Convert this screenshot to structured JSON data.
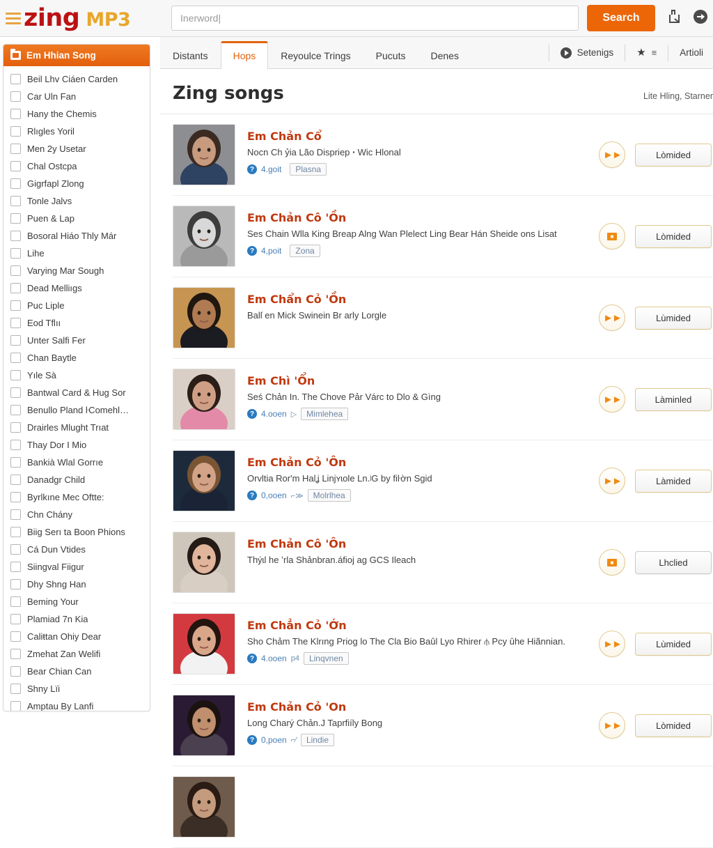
{
  "header": {
    "brand_first": "zing",
    "brand_second": "MP3",
    "menu_icon": "hamburger-icon",
    "search": {
      "value": "",
      "placeholder": "Inerword|",
      "button_label": "Search"
    },
    "icons": [
      {
        "name": "upload-icon",
        "label": "Upload"
      },
      {
        "name": "login-arrow-icon",
        "label": "Sign in"
      }
    ]
  },
  "sidebar": {
    "header_label": "Em Hhian Song",
    "header_icon": "folder-icon",
    "items": [
      {
        "label": "Beil Lhv Ciáen Carden",
        "checked": false
      },
      {
        "label": "Car Uln Fan",
        "checked": false
      },
      {
        "label": "Hany the Chemis",
        "checked": false
      },
      {
        "label": "Rlıgles Yoril",
        "checked": false
      },
      {
        "label": "Men 2y Usetar",
        "checked": false
      },
      {
        "label": "Chal Ostcpa",
        "checked": false
      },
      {
        "label": "Gigrfapl Zlong",
        "checked": false
      },
      {
        "label": "Tonle Jalvs",
        "checked": false
      },
      {
        "label": "Puen & Lap",
        "checked": false
      },
      {
        "label": "Bosoral Hiáo Thly Már",
        "checked": false
      },
      {
        "label": "Lihe",
        "checked": false
      },
      {
        "label": "Varying Mar Sough",
        "checked": false
      },
      {
        "label": "Dead Melliıgs",
        "checked": false
      },
      {
        "label": "Puc Liple",
        "checked": false
      },
      {
        "label": "Eod Tflıı",
        "checked": false
      },
      {
        "label": "Unter Salfi Fer",
        "checked": false
      },
      {
        "label": "Chan Baytle",
        "checked": false
      },
      {
        "label": "Yıle Sà",
        "checked": false
      },
      {
        "label": "Bantwal Card & Hug Sor",
        "checked": false
      },
      {
        "label": "Benullo Pland ŀComehl…",
        "checked": false
      },
      {
        "label": "Drairles Mlught Trıat",
        "checked": false
      },
      {
        "label": "Thay Dor I Mio",
        "checked": false
      },
      {
        "label": "Bankià Wlal Gorrıe",
        "checked": false
      },
      {
        "label": "Danadgr Child",
        "checked": false
      },
      {
        "label": "Byrlkıne Mec Oftte:",
        "checked": false
      },
      {
        "label": "Chn Chány",
        "checked": false
      },
      {
        "label": "Biig Serı ta Boon Phions",
        "checked": false
      },
      {
        "label": "Cá Dun Vtides",
        "checked": false
      },
      {
        "label": "Siingval Fiigur",
        "checked": false
      },
      {
        "label": "Dhy Shng Han",
        "checked": false
      },
      {
        "label": "Bemіng Your",
        "checked": false
      },
      {
        "label": "Plamiad 7n Kia",
        "checked": false
      },
      {
        "label": "Caliŧtan Ohiy Dear",
        "checked": false
      },
      {
        "label": "Zmehat Zan Welifi",
        "checked": false
      },
      {
        "label": "Bear Chian Can",
        "checked": false
      },
      {
        "label": "Shny Lïi",
        "checked": false
      },
      {
        "label": "Amptau By Lanfi",
        "checked": false
      }
    ]
  },
  "tabs": {
    "items": [
      {
        "label": "Distants",
        "active": false
      },
      {
        "label": "Hops",
        "active": true
      },
      {
        "label": "Reyoulce Trings",
        "active": false
      },
      {
        "label": "Pucuts",
        "active": false
      },
      {
        "label": "Denes",
        "active": false
      }
    ],
    "right": [
      {
        "label": "Setenigs",
        "icon": "play-circle-icon"
      },
      {
        "label": "",
        "icon": "star-filter-icon"
      },
      {
        "label": "Artioli",
        "icon": null
      }
    ]
  },
  "main": {
    "title": "Zing songs",
    "title_right": "Lite Hling, Starner",
    "songs": [
      {
        "title": "Em Chản Cổ",
        "desc": "Nocn Ch ỷia Lão Dispriep ꞏ Wic Hlonal",
        "meta": {
          "count": "4.goit",
          "arrow": "",
          "tag": "Plasna"
        },
        "action_icon": "fast-forward-icon",
        "action_label": "Lòmided",
        "thumb": {
          "bg": "#8d8e92",
          "skin": "#c89b7f",
          "hair": "#3a2a22",
          "cloth": "#2e4262"
        }
      },
      {
        "title": "Em Chản Cô 'Ồn",
        "desc": "Ses Chain Wlla King Breap Alng Wan Plelect Ling Bear Hán Sheide ons Lisat",
        "meta": {
          "count": "4,poit",
          "arrow": "",
          "tag": "Zona"
        },
        "action_icon": "stop-square-icon",
        "action_label": "Lòmided",
        "thumb": {
          "bg": "#b9b9b9",
          "skin": "#d8d8d8",
          "hair": "#3d3d3d",
          "cloth": "#9a9a9a"
        }
      },
      {
        "title": "Em Chẩn Cỏ 'Ồn",
        "desc": "Balſ en Mick Swinein Br arly Lorgle",
        "meta": null,
        "action_icon": "fast-forward-icon",
        "action_label": "Lùmided",
        "thumb": {
          "bg": "#c79552",
          "skin": "#b07b52",
          "hair": "#1f1710",
          "cloth": "#1b1b22"
        }
      },
      {
        "title": "Em Chì 'Ổn",
        "desc": "Seś Chản In. The Chove Pảr Várc to Dlo & Gìng",
        "meta": {
          "count": "4.ooen",
          "arrow": "▷",
          "tag": "Mimlehea"
        },
        "action_icon": "fast-forward-icon",
        "action_label": "Làminled",
        "thumb": {
          "bg": "#d9cfc6",
          "skin": "#cf9f85",
          "hair": "#2b1d18",
          "cloth": "#e38aa8"
        }
      },
      {
        "title": "Em Chản Cỏ 'Ôn",
        "desc": "Orvltia Ror'm Halʝ Linjʏɩole Ln.ʲG by fiŀờn Sgid",
        "meta": {
          "count": "0,ooen",
          "arrow": "⌐≫",
          "tag": "Molrlhea"
        },
        "action_icon": "fast-forward-icon",
        "action_label": "Làmided",
        "thumb": {
          "bg": "#1d2a3c",
          "skin": "#d3a387",
          "hair": "#7a5533",
          "cloth": "#1a2436"
        }
      },
      {
        "title": "Em Chản Cô 'Ôn",
        "desc": "Thýɩl he ʼrla Shảnbran.áfioj ag GCS Ileach",
        "meta": null,
        "action_icon": "stop-square-icon",
        "action_label": "Lhclied",
        "thumb": {
          "bg": "#cfc6bb",
          "skin": "#e0b59c",
          "hair": "#241a16",
          "cloth": "#d9cec4"
        }
      },
      {
        "title": "Em Chẳn Cỏ 'Ớn",
        "desc": "Sho Chảm The Klrıng Priog lo The Cla Bio Baûl Lyo Rhirer ⫛ Pcy ȗhe Hiãnnian.",
        "meta": {
          "count": "4.ooen",
          "arrow": "p4",
          "tag": "Linqvnen"
        },
        "action_icon": "fast-forward-icon",
        "action_label": "Lùmided",
        "thumb": {
          "bg": "#d33a3f",
          "skin": "#d9a68a",
          "hair": "#241410",
          "cloth": "#f2f2f2"
        }
      },
      {
        "title": "Em Chản Cỏ 'On",
        "desc": "Long Charý Chản.J Taprfiíly Bong",
        "meta": {
          "count": "0,poen",
          "arrow": "⌐⁄",
          "tag": "Lindie"
        },
        "action_icon": "fast-forward-icon",
        "action_label": "Lòmided",
        "thumb": {
          "bg": "#2a1a33",
          "skin": "#c08f6e",
          "hair": "#1a1210",
          "cloth": "#4a4050"
        }
      },
      {
        "title": "",
        "desc": "",
        "meta": null,
        "action_icon": null,
        "action_label": "",
        "thumb": {
          "bg": "#6f5b4b",
          "skin": "#c49b7d",
          "hair": "#2a1c14",
          "cloth": "#3a2e26"
        }
      }
    ]
  }
}
